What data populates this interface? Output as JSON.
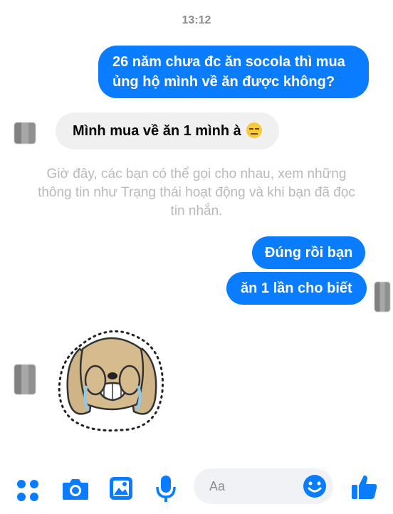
{
  "header": {
    "time": "13:12"
  },
  "messages": {
    "out_1_line1": "26 năm chưa đc ăn socola thì mua",
    "out_1_line2": "ủng hộ mình về ăn được không?",
    "in_1": "Mình mua về ăn 1 mình à",
    "in_1_emoji": "expressionless-face",
    "notice_line1": "Giờ đây, các bạn có thể gọi cho nhau, xem những",
    "notice_line2": "thông tin như Trạng thái hoạt động và khi bạn đã đọc",
    "notice_line3": "tin nhắn.",
    "out_2": "Đúng rồi bạn",
    "out_3": "ăn 1 lần cho biết",
    "sticker": "crying-dog-sticker"
  },
  "composer": {
    "placeholder": "Aa"
  },
  "colors": {
    "accent": "#0a7cff",
    "incoming_bg": "#f0f0f0",
    "notice_text": "#b8b9bc"
  },
  "icons": [
    "menu-dots-icon",
    "camera-icon",
    "gallery-icon",
    "microphone-icon",
    "emoji-icon",
    "like-icon"
  ]
}
